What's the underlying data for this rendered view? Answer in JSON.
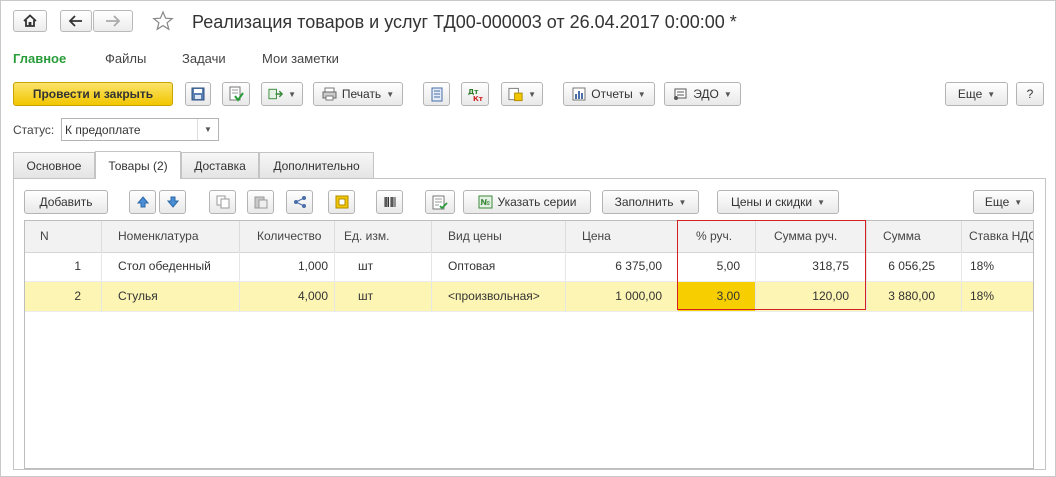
{
  "window": {
    "title": "Реализация товаров и услуг ТД00-000003 от 26.04.2017 0:00:00 *"
  },
  "nav": {
    "home_icon": "home-icon",
    "back_icon": "arrow-left-icon",
    "forward_icon": "arrow-right-icon",
    "favorite_icon": "star-icon"
  },
  "menu": {
    "items": [
      "Главное",
      "Файлы",
      "Задачи",
      "Мои заметки"
    ]
  },
  "toolbar": {
    "post_close": "Провести и закрыть",
    "print": "Печать",
    "reports": "Отчеты",
    "edo": "ЭДО",
    "more": "Еще",
    "help": "?"
  },
  "status": {
    "label": "Статус:",
    "value": "К предоплате"
  },
  "tabs": [
    "Основное",
    "Товары (2)",
    "Доставка",
    "Дополнительно"
  ],
  "goods_toolbar": {
    "add": "Добавить",
    "series": "Указать серии",
    "fill": "Заполнить",
    "prices": "Цены и скидки",
    "more": "Еще"
  },
  "table": {
    "columns": [
      "N",
      "Номенклатура",
      "Количество",
      "Ед. изм.",
      "Вид цены",
      "Цена",
      "% руч.",
      "Сумма руч.",
      "Сумма",
      "Ставка НДС"
    ],
    "rows": [
      [
        "1",
        "Стол обеденный",
        "1,000",
        "шт",
        "Оптовая",
        "6 375,00",
        "5,00",
        "318,75",
        "6 056,25",
        "18%"
      ],
      [
        "2",
        "Стулья",
        "4,000",
        "шт",
        "<произвольная>",
        "1 000,00",
        "3,00",
        "120,00",
        "3 880,00",
        "18%"
      ]
    ]
  },
  "colors": {
    "accent_green": "#2a9d3a",
    "primary_button": "#f2c600",
    "selected_row": "#fdf5b3",
    "highlight_box": "#d32020"
  }
}
